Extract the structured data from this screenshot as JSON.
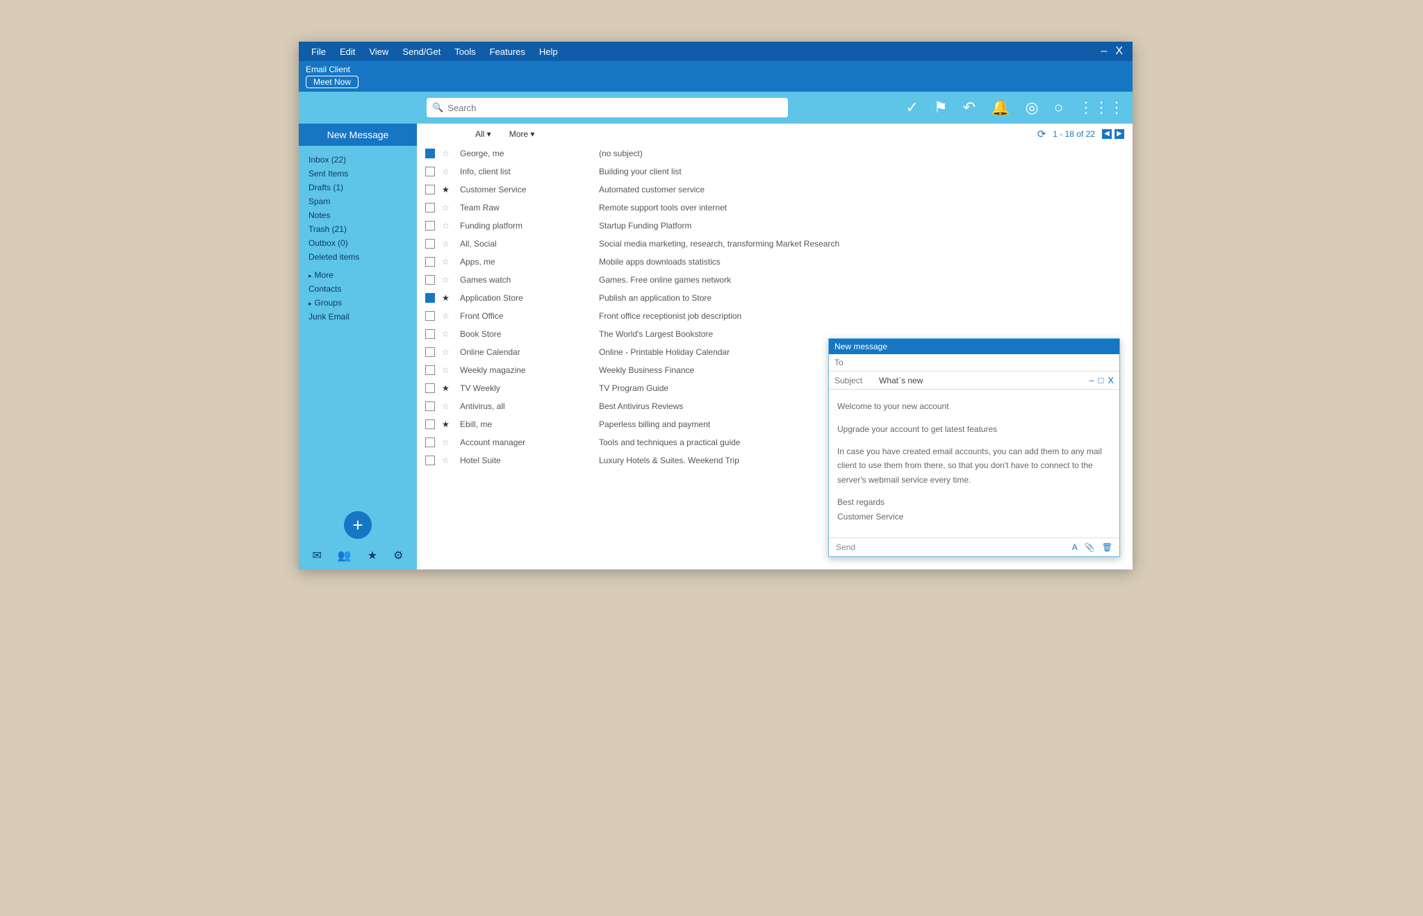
{
  "menu": {
    "items": [
      "File",
      "Edit",
      "View",
      "Send/Get",
      "Tools",
      "Features",
      "Help"
    ]
  },
  "window": {
    "minimize": "–",
    "close": "X"
  },
  "title": {
    "brand": "Email Client",
    "meet": "Meet Now"
  },
  "search": {
    "placeholder": "Search"
  },
  "toolbar_icons": [
    "checkmark",
    "flag",
    "undo",
    "bell",
    "target",
    "circle",
    "grid"
  ],
  "sidebar": {
    "new_message": "New Message",
    "folders": [
      {
        "label": "Inbox (22)"
      },
      {
        "label": "Sent Items"
      },
      {
        "label": "Drafts (1)"
      },
      {
        "label": "Spam"
      },
      {
        "label": "Notes"
      },
      {
        "label": "Trash (21)"
      },
      {
        "label": "Outbox (0)"
      },
      {
        "label": "Deleted items"
      }
    ],
    "more": "More",
    "contacts": "Contacts",
    "groups": "Groups",
    "junk": "Junk Email"
  },
  "list": {
    "filter_all": "All ▾",
    "filter_more": "More ▾",
    "count": "1 - 18 of 22",
    "rows": [
      {
        "checked": true,
        "star": false,
        "sender": "George, me",
        "subject": "(no subject)"
      },
      {
        "checked": false,
        "star": false,
        "sender": "Info, client list",
        "subject": "Building your client list"
      },
      {
        "checked": false,
        "star": true,
        "sender": "Customer Service",
        "subject": "Automated customer service"
      },
      {
        "checked": false,
        "star": false,
        "sender": "Team Raw",
        "subject": "Remote support tools over internet"
      },
      {
        "checked": false,
        "star": false,
        "sender": "Funding platform",
        "subject": "Startup Funding Platform"
      },
      {
        "checked": false,
        "star": false,
        "sender": "All, Social",
        "subject": "Social media marketing, research, transforming Market Research"
      },
      {
        "checked": false,
        "star": false,
        "sender": "Apps, me",
        "subject": "Mobile apps downloads statistics"
      },
      {
        "checked": false,
        "star": false,
        "sender": "Games watch",
        "subject": "Games. Free online games network"
      },
      {
        "checked": true,
        "star": true,
        "sender": "Application Store",
        "subject": "Publish an application to Store"
      },
      {
        "checked": false,
        "star": false,
        "sender": "Front Office",
        "subject": "Front office receptionist job description"
      },
      {
        "checked": false,
        "star": false,
        "sender": "Book Store",
        "subject": "The World's Largest  Bookstore"
      },
      {
        "checked": false,
        "star": false,
        "sender": "Online Calendar",
        "subject": "Online - Printable Holiday Calendar"
      },
      {
        "checked": false,
        "star": false,
        "sender": "Weekly magazine",
        "subject": "Weekly Business Finance"
      },
      {
        "checked": false,
        "star": true,
        "sender": "TV Weekly",
        "subject": "TV Program Guide"
      },
      {
        "checked": false,
        "star": false,
        "sender": "Antivirus, all",
        "subject": "Best Antivirus Reviews"
      },
      {
        "checked": false,
        "star": true,
        "sender": "Ebill, me",
        "subject": "Paperless billing and payment"
      },
      {
        "checked": false,
        "star": false,
        "sender": "Account manager",
        "subject": "Tools and techniques a practical guide"
      },
      {
        "checked": false,
        "star": false,
        "sender": "Hotel Suite",
        "subject": "Luxury Hotels & Suites. Weekend Trip"
      }
    ]
  },
  "compose": {
    "title": "New message",
    "to": "To",
    "subject": "Subject",
    "whats_new": "What´s new",
    "body_greeting": "Welcome to your new account",
    "body_line1": "Upgrade your account to get latest features",
    "body_line2": "In case you have created email accounts,  you can add them to any mail client to use them from there, so that you don't have to connect to the server's webmail service every time.",
    "body_signoff": "Best regards",
    "body_signature": "Customer Service",
    "send": "Send",
    "footer_format": "A",
    "footer_attach_icon": "attachment",
    "footer_trash_icon": "trash"
  }
}
